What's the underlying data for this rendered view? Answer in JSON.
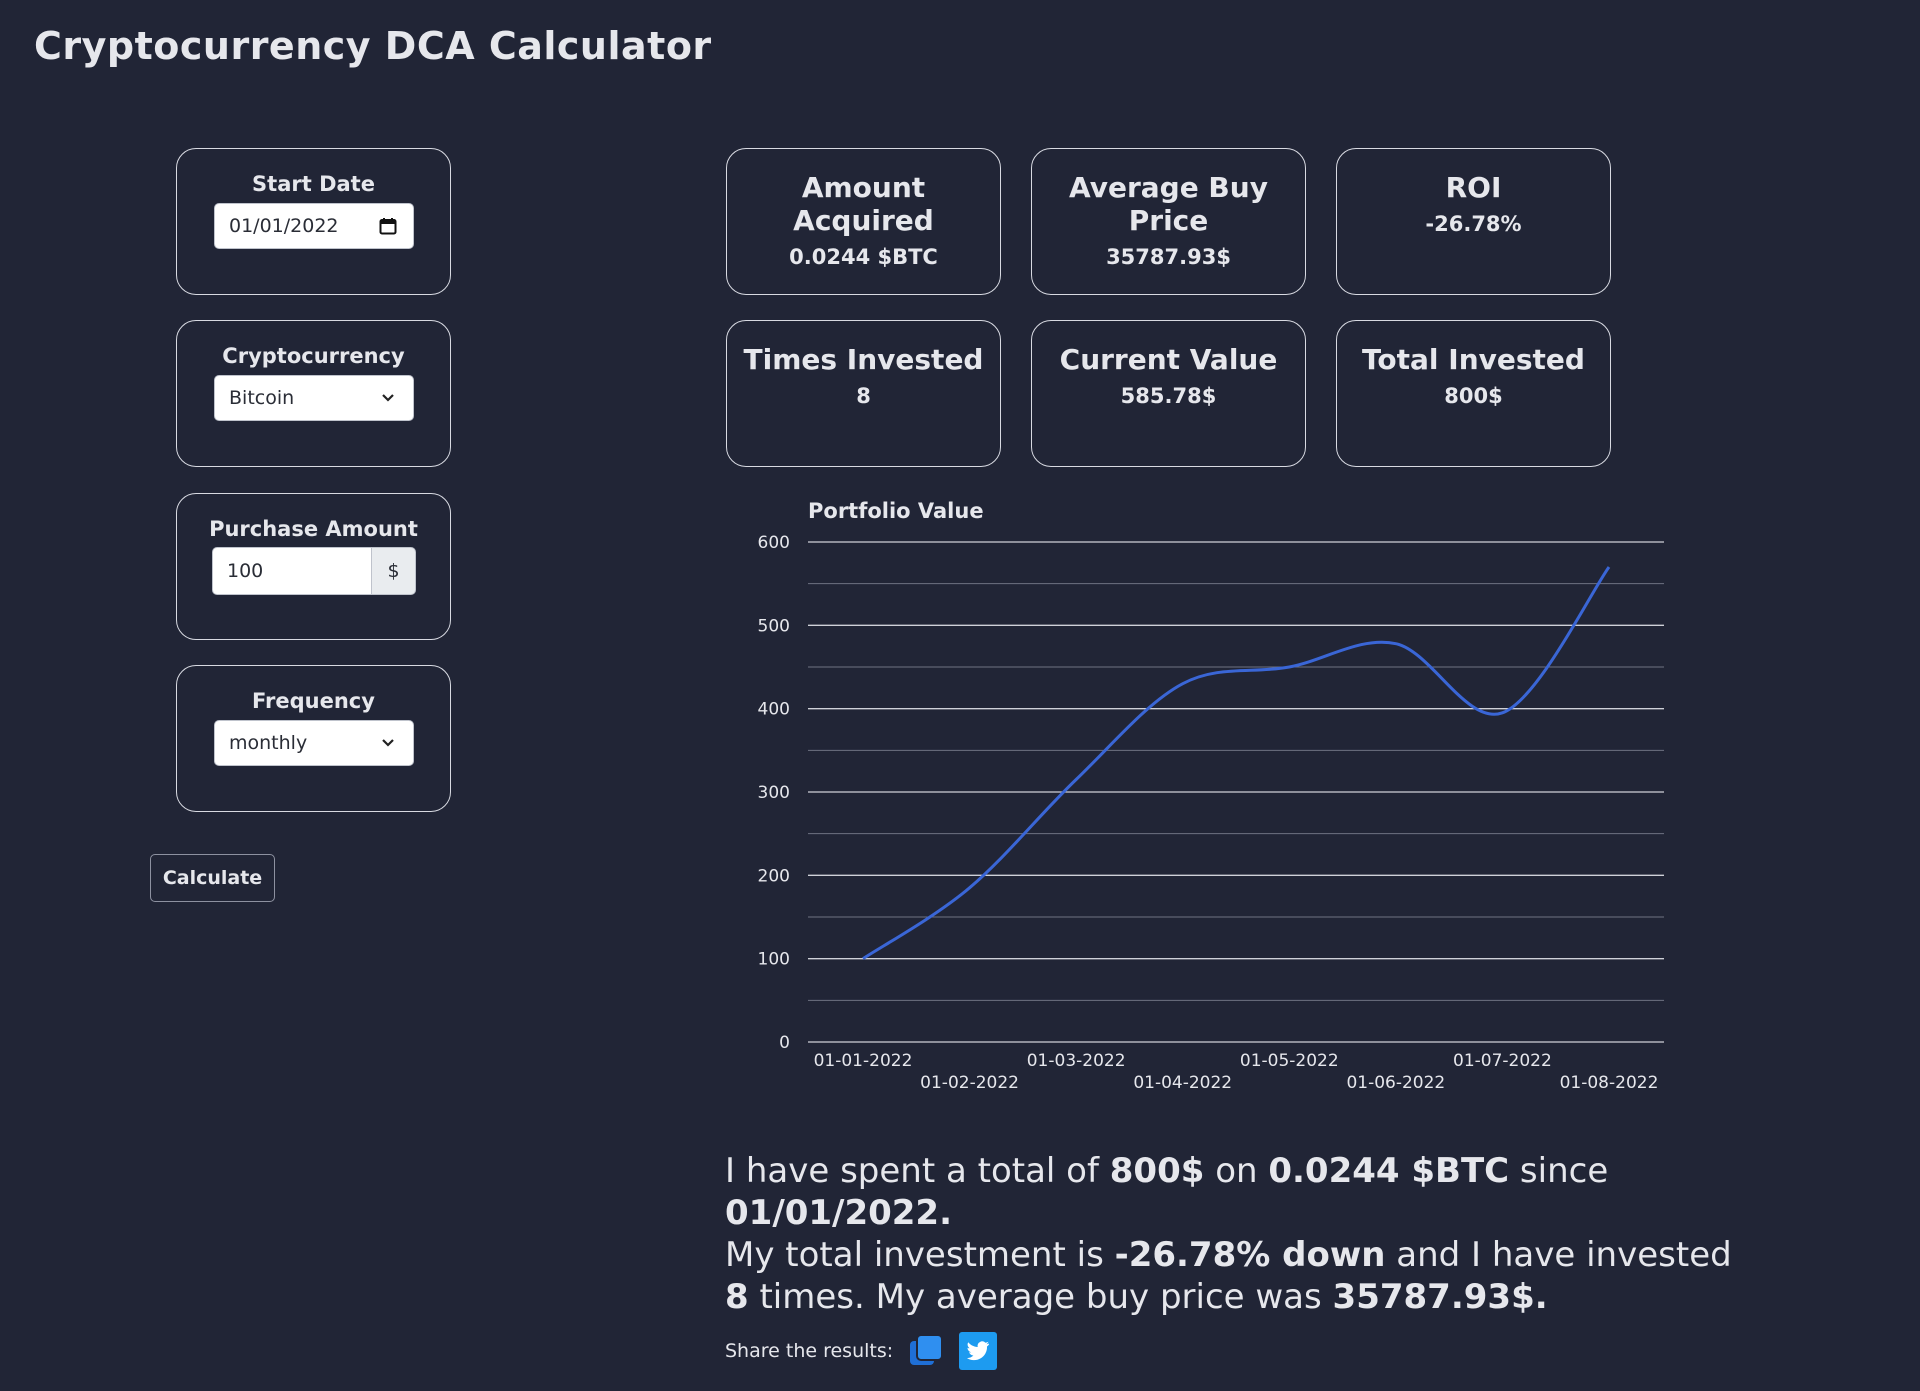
{
  "app": {
    "title": "Cryptocurrency DCA Calculator"
  },
  "inputs": {
    "start_date": {
      "label": "Start Date",
      "value": "01/01/2022"
    },
    "cryptocurrency": {
      "label": "Cryptocurrency",
      "value": "Bitcoin"
    },
    "purchase_amount": {
      "label": "Purchase Amount",
      "value": "100",
      "addon": "$"
    },
    "frequency": {
      "label": "Frequency",
      "value": "monthly"
    },
    "calculate_label": "Calculate"
  },
  "stats": [
    {
      "label": "Amount Acquired",
      "value": "0.0244 $BTC"
    },
    {
      "label": "Average Buy Price",
      "value": "35787.93$"
    },
    {
      "label": "ROI",
      "value": "-26.78%"
    },
    {
      "label": "Times Invested",
      "value": "8"
    },
    {
      "label": "Current Value",
      "value": "585.78$"
    },
    {
      "label": "Total Invested",
      "value": "800$"
    }
  ],
  "summary": {
    "p1": "I have spent a total of ",
    "total": "800$",
    "p2": " on ",
    "amount": "0.0244 $BTC",
    "p3": " since ",
    "date": "01/01/2022.",
    "p4": "My total investment is ",
    "roi": "-26.78% down",
    "p5": " and I have invested ",
    "times": "8",
    "p6": " times. My average buy price was ",
    "avg": "35787.93$."
  },
  "share": {
    "label": "Share the results:"
  },
  "colors": {
    "background": "#212536",
    "line": "#3a66d6",
    "twitter": "#1d9bf0",
    "copy": "#2f80ed"
  },
  "chart_data": {
    "type": "line",
    "title": "Portfolio Value",
    "x": [
      "01-01-2022",
      "01-02-2022",
      "01-03-2022",
      "01-04-2022",
      "01-05-2022",
      "01-06-2022",
      "01-07-2022",
      "01-08-2022"
    ],
    "values": [
      100,
      185,
      315,
      430,
      450,
      478,
      395,
      570
    ],
    "ylim": [
      0,
      600
    ],
    "yticks": [
      0,
      100,
      200,
      300,
      400,
      500,
      600
    ],
    "grid": true,
    "xlabel": "",
    "ylabel": ""
  }
}
